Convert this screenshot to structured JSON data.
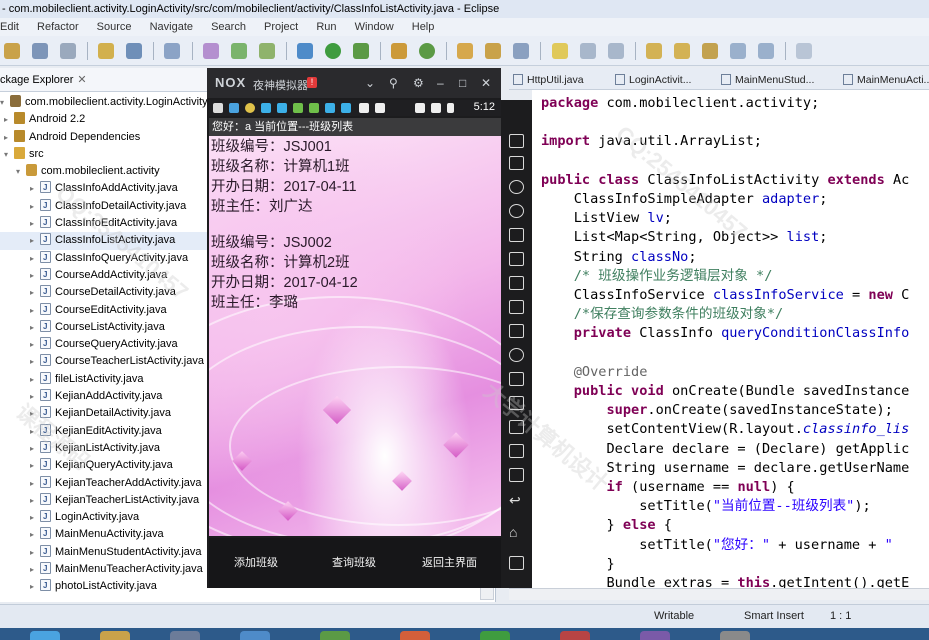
{
  "window": {
    "title": "- com.mobileclient.activity.LoginActivity/src/com/mobileclient/activity/ClassInfoListActivity.java - Eclipse"
  },
  "menubar": {
    "items": [
      "Edit",
      "Refactor",
      "Source",
      "Navigate",
      "Search",
      "Project",
      "Run",
      "Window",
      "Help"
    ]
  },
  "package_explorer": {
    "tab_label": "ckage Explorer",
    "project": "com.mobileclient.activity.LoginActivity",
    "nodes": [
      "Android 2.2",
      "Android Dependencies",
      "src",
      "com.mobileclient.activity"
    ],
    "files": [
      "ClassInfoAddActivity.java",
      "ClassInfoDetailActivity.java",
      "ClassInfoEditActivity.java",
      "ClassInfoListActivity.java",
      "ClassInfoQueryActivity.java",
      "CourseAddActivity.java",
      "CourseDetailActivity.java",
      "CourseEditActivity.java",
      "CourseListActivity.java",
      "CourseQueryActivity.java",
      "CourseTeacherListActivity.java",
      "fileListActivity.java",
      "KejianAddActivity.java",
      "KejianDetailActivity.java",
      "KejianEditActivity.java",
      "KejianListActivity.java",
      "KejianQueryActivity.java",
      "KejianTeacherAddActivity.java",
      "KejianTeacherListActivity.java",
      "LoginActivity.java",
      "MainMenuActivity.java",
      "MainMenuStudentActivity.java",
      "MainMenuTeacherActivity.java",
      "photoListActivity.java"
    ]
  },
  "emulator": {
    "brand": "NOX",
    "name": "夜神模拟器",
    "badge": "!",
    "clock": "5:12",
    "app_title": "您好：a  当前位置---班级列表",
    "classes": [
      {
        "no": "班级编号：JSJ001",
        "name": "班级名称：计算机1班",
        "date": "开办日期：2017-04-11",
        "teacher": "班主任：刘广达"
      },
      {
        "no": "班级编号：JSJ002",
        "name": "班级名称：计算机2班",
        "date": "开办日期：2017-04-12",
        "teacher": "班主任：李璐"
      }
    ],
    "buttons": {
      "add": "添加班级",
      "query": "查询班级",
      "back": "返回主界面"
    }
  },
  "editor": {
    "tabs": [
      "HttpUtil.java",
      "LoginActivit...",
      "MainMenuStud...",
      "MainMenuActi..."
    ]
  },
  "status": {
    "mode": "Writable",
    "insert": "Smart Insert",
    "pos": "1 : 1"
  },
  "watermarks": [
    "CQ:2545410457",
    "大学计算机设计",
    "QQ:2545410457",
    "课程源码"
  ]
}
